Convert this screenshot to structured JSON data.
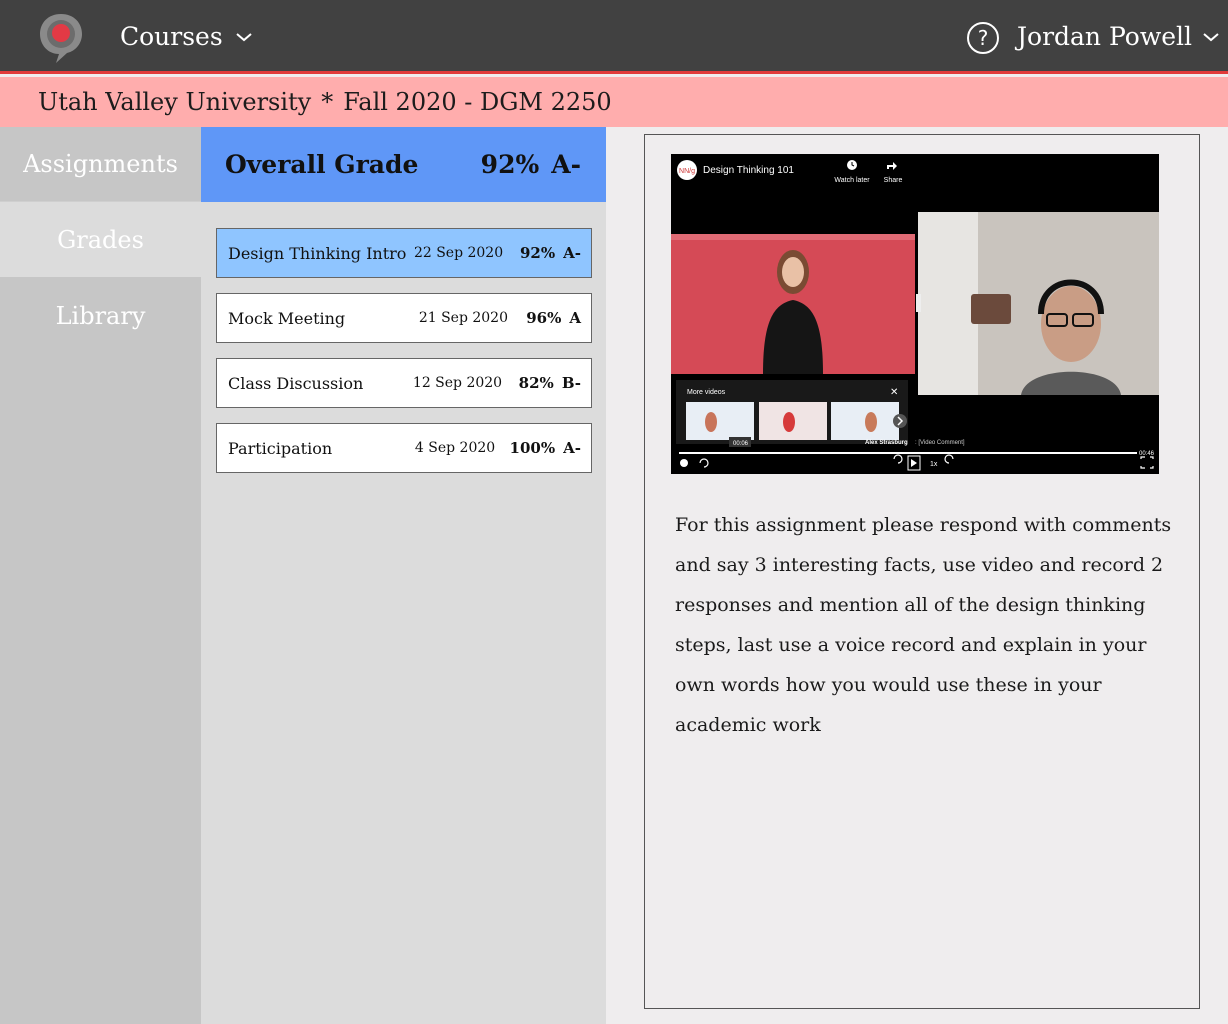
{
  "header": {
    "logo_icon": "chat-bubble-record-icon",
    "courses_label": "Courses",
    "help_symbol": "?",
    "user_name": "Jordan Powell"
  },
  "context": {
    "school": "Utah Valley University",
    "separator": "*",
    "course": "Fall 2020 - DGM 2250"
  },
  "sidebar": {
    "items": [
      {
        "label": "Assignments"
      },
      {
        "label": "Grades"
      },
      {
        "label": "Library"
      }
    ]
  },
  "grades": {
    "overall_label": "Overall Grade",
    "overall_percent": "92%",
    "overall_letter": "A-",
    "rows": [
      {
        "name": "Design Thinking Intro",
        "date": "22 Sep 2020",
        "percent": "92%",
        "letter": "A-"
      },
      {
        "name": "Mock Meeting",
        "date": "21 Sep 2020",
        "percent": "96%",
        "letter": "A"
      },
      {
        "name": "Class Discussion",
        "date": "12 Sep 2020",
        "percent": "82%",
        "letter": "B-"
      },
      {
        "name": "Participation",
        "date": "4 Sep 2020",
        "percent": "100%",
        "letter": "A-"
      }
    ]
  },
  "video": {
    "channel_badge": "NN/g",
    "title": "Design Thinking 101",
    "watch_later": "Watch later",
    "share": "Share",
    "more_videos": "More videos",
    "commenter": "Alex Strasburg",
    "comment_tag": ": [Video Comment]",
    "current_time": "00:06",
    "end_time": "00:46",
    "speed": "1x"
  },
  "instructions": "For this assignment please respond with comments and say 3 interesting facts, use video and record 2 responses and mention all of the design thinking steps, last use a voice record and explain in your own words how you would use these in your academic work",
  "colors": {
    "topbar": "#414141",
    "accent_red": "#e13b3b",
    "subheader": "#ffadad",
    "overall_blue": "#5f97f7",
    "active_row": "#8fc5ff"
  }
}
